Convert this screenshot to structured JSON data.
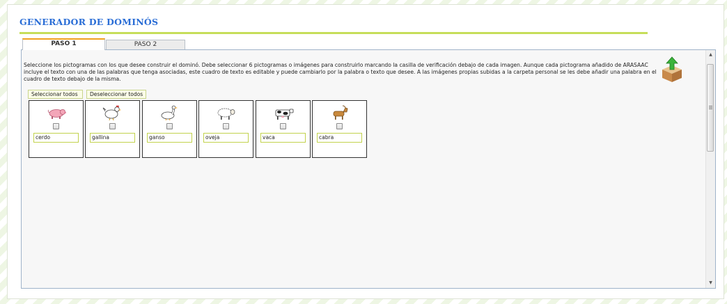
{
  "header": {
    "title": "GENERADOR DE DOMINÓS"
  },
  "tabs": [
    {
      "label": "PASO 1",
      "active": true
    },
    {
      "label": "PASO 2",
      "active": false
    }
  ],
  "step1": {
    "instructions": "Seleccione los pictogramas con los que desee construir el dominó. Debe seleccionar 6 pictogramas o imágenes para construirlo marcando la casilla de verificación debajo de cada imagen. Aunque cada pictograma añadido de ARASAAC incluye el texto con una de las palabras que tenga asociadas, este cuadro de texto es editable y puede cambiarlo por la palabra o texto que desee. A las imágenes propias subidas a la carpeta personal se les debe añadir una palabra en el cuadro de texto debajo de la misma.",
    "select_all_label": "Seleccionar todos",
    "deselect_all_label": "Deseleccionar todos",
    "pictograms": [
      {
        "icon": "pig-icon",
        "word": "cerdo",
        "checked": false
      },
      {
        "icon": "hen-icon",
        "word": "gallina",
        "checked": false
      },
      {
        "icon": "goose-icon",
        "word": "ganso",
        "checked": false
      },
      {
        "icon": "sheep-icon",
        "word": "oveja",
        "checked": false
      },
      {
        "icon": "cow-icon",
        "word": "vaca",
        "checked": false
      },
      {
        "icon": "goat-icon",
        "word": "cabra",
        "checked": false
      }
    ]
  },
  "icons": {
    "upload": "upload-box-icon"
  }
}
